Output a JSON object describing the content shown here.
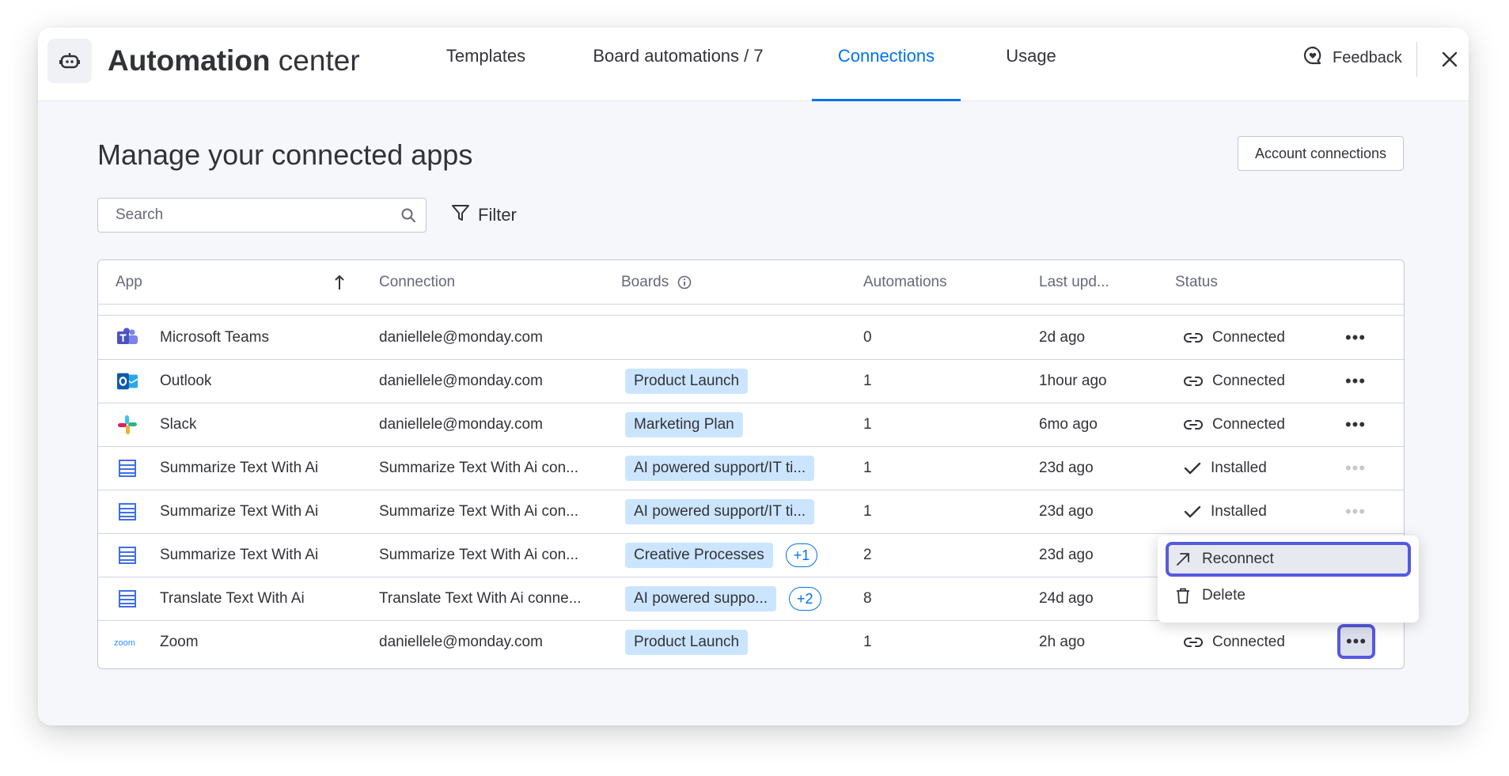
{
  "header": {
    "brand_bold": "Automation",
    "brand_light": " center",
    "tabs": [
      {
        "label": "Templates",
        "active": false
      },
      {
        "label": "Board automations / 7",
        "active": false
      },
      {
        "label": "Connections",
        "active": true
      },
      {
        "label": "Usage",
        "active": false
      }
    ],
    "feedback_label": "Feedback",
    "icons": {
      "logo": "robot-icon",
      "feedback": "chat-heart-icon",
      "close": "close-icon"
    }
  },
  "main": {
    "title": "Manage your connected apps",
    "account_connections_label": "Account connections",
    "search": {
      "placeholder": "Search",
      "value": ""
    },
    "filter_label": "Filter"
  },
  "table": {
    "columns": {
      "app": "App",
      "connection": "Connection",
      "boards": "Boards",
      "automations": "Automations",
      "last_updated": "Last upd...",
      "status": "Status"
    },
    "rows": [
      {
        "app": "Microsoft Teams",
        "icon": "microsoft-teams-icon",
        "connection": "daniellele@monday.com",
        "board": "",
        "extra": "",
        "automations": "0",
        "updated": "2d ago",
        "status": "Connected",
        "status_icon": "link-icon",
        "menu_dim": false
      },
      {
        "app": "Outlook",
        "icon": "outlook-icon",
        "connection": "daniellele@monday.com",
        "board": "Product Launch",
        "extra": "",
        "automations": "1",
        "updated": "1hour ago",
        "status": "Connected",
        "status_icon": "link-icon",
        "menu_dim": false
      },
      {
        "app": "Slack",
        "icon": "slack-icon",
        "connection": "daniellele@monday.com",
        "board": "Marketing Plan",
        "extra": "",
        "automations": "1",
        "updated": "6mo ago",
        "status": "Connected",
        "status_icon": "link-icon",
        "menu_dim": false
      },
      {
        "app": "Summarize Text With Ai",
        "icon": "list-app-icon",
        "connection": "Summarize Text With Ai con...",
        "board": "AI powered support/IT ti...",
        "extra": "",
        "automations": "1",
        "updated": "23d ago",
        "status": "Installed",
        "status_icon": "check-icon",
        "menu_dim": true
      },
      {
        "app": "Summarize Text With Ai",
        "icon": "list-app-icon",
        "connection": "Summarize Text With Ai con...",
        "board": "AI powered support/IT ti...",
        "extra": "",
        "automations": "1",
        "updated": "23d ago",
        "status": "Installed",
        "status_icon": "check-icon",
        "menu_dim": true
      },
      {
        "app": "Summarize Text With Ai",
        "icon": "list-app-icon",
        "connection": "Summarize Text With Ai con...",
        "board": "Creative Processes",
        "extra": "+1",
        "automations": "2",
        "updated": "23d ago",
        "status": "",
        "status_icon": "",
        "menu_dim": false
      },
      {
        "app": "Translate Text With Ai",
        "icon": "list-app-icon",
        "connection": "Translate Text With Ai conne...",
        "board": "AI powered suppo...",
        "extra": "+2",
        "automations": "8",
        "updated": "24d ago",
        "status": "",
        "status_icon": "",
        "menu_dim": false
      },
      {
        "app": "Zoom",
        "icon": "zoom-icon",
        "connection": "daniellele@monday.com",
        "board": "Product Launch",
        "extra": "",
        "automations": "1",
        "updated": "2h ago",
        "status": "Connected",
        "status_icon": "link-icon",
        "menu_dim": false
      }
    ]
  },
  "context_menu": {
    "items": [
      {
        "label": "Reconnect",
        "icon": "arrow-up-right-icon"
      },
      {
        "label": "Delete",
        "icon": "trash-icon"
      }
    ]
  },
  "colors": {
    "accent": "#0073ea",
    "focus_ring": "#5559df",
    "tag_bg": "#cce5ff"
  }
}
